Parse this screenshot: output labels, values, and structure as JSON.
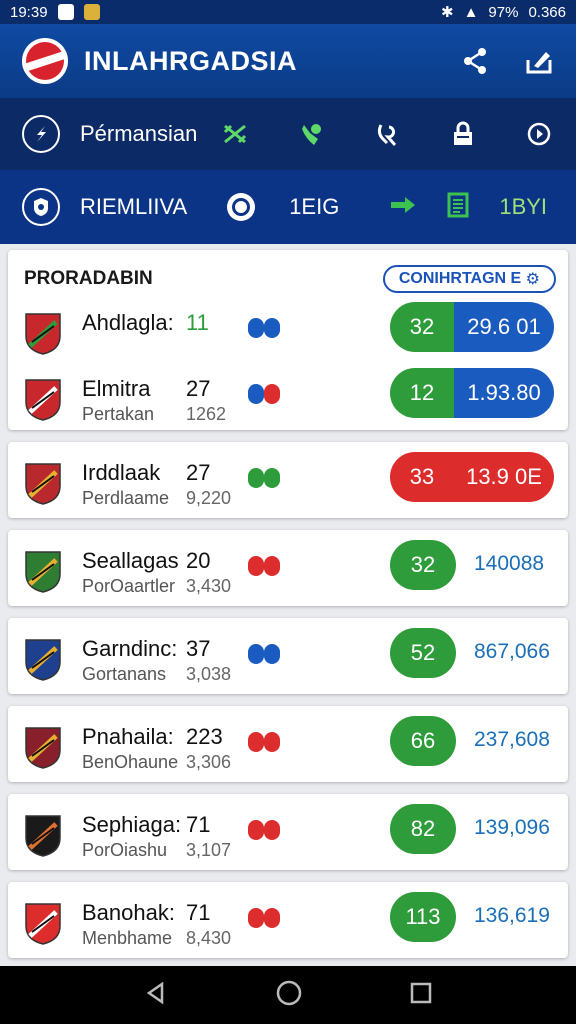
{
  "status_bar": {
    "time": "19:39",
    "battery": "97%",
    "right_text": "0.366"
  },
  "app_bar": {
    "title": "INLAHRGADSIA",
    "share_icon": "share-icon",
    "edit_icon": "edit-icon"
  },
  "nav_row": {
    "label": "Pérmansian"
  },
  "filter_row": {
    "label": "RIEMLIIVA",
    "value1": "1EIG",
    "value2": "1BYI"
  },
  "league": {
    "title": "PRORADABIN",
    "button": "CONIHRTAGN E"
  },
  "teams": [
    {
      "name": "Ahdlagla:",
      "sub": "",
      "score": "11",
      "total": "",
      "score_color": "green",
      "form": [
        "#1a5bbf",
        "#1a5bbf"
      ],
      "btn_left": "32",
      "btn_right": "29.6 01",
      "btn_type": "split"
    },
    {
      "name": "Elmitra",
      "sub": "Pertakan",
      "score": "27",
      "total": "1262",
      "score_color": "",
      "form": [
        "#1a5bbf",
        "#dd2c2c"
      ],
      "btn_left": "12",
      "btn_right": "1.93.80",
      "btn_type": "split"
    },
    {
      "name": "Irddlaak",
      "sub": "Perdlaame",
      "score": "27",
      "total": "9,220",
      "score_color": "",
      "form": [
        "#2e9c3a",
        "#2e9c3a"
      ],
      "btn_left": "33",
      "btn_right": "13.9 0E",
      "btn_type": "red"
    },
    {
      "name": "Seallagas",
      "sub": "PorOaartler",
      "score": "20",
      "total": "3,430",
      "score_color": "",
      "form": [
        "#dd2c2c",
        "#dd2c2c"
      ],
      "btn_left": "32",
      "btn_right": "140088",
      "btn_type": "green"
    },
    {
      "name": "Garndinc:",
      "sub": "Gortanans",
      "score": "37",
      "total": "3,038",
      "score_color": "",
      "form": [
        "#1a5bbf",
        "#1a5bbf"
      ],
      "btn_left": "52",
      "btn_right": "867,066",
      "btn_type": "green"
    },
    {
      "name": "Pnahaila:",
      "sub": "BenOhaune",
      "score": "223",
      "total": "3,306",
      "score_color": "",
      "form": [
        "#dd2c2c",
        "#dd2c2c"
      ],
      "btn_left": "66",
      "btn_right": "237,608",
      "btn_type": "green"
    },
    {
      "name": "Sephiaga:",
      "sub": "PorOiashu",
      "score": "71",
      "total": "3,107",
      "score_color": "",
      "form": [
        "#dd2c2c",
        "#dd2c2c"
      ],
      "btn_left": "82",
      "btn_right": "139,096",
      "btn_type": "green"
    },
    {
      "name": "Banohak:",
      "sub": "Menbhame",
      "score": "71",
      "total": "8,430",
      "score_color": "",
      "form": [
        "#dd2c2c",
        "#dd2c2c"
      ],
      "btn_left": "113",
      "btn_right": "136,619",
      "btn_type": "green"
    }
  ],
  "colors": {
    "primary": "#0f4aa3",
    "dark": "#0c2a66",
    "green": "#2e9c3a",
    "red": "#dd2c2c",
    "blue": "#1a5bbf"
  }
}
